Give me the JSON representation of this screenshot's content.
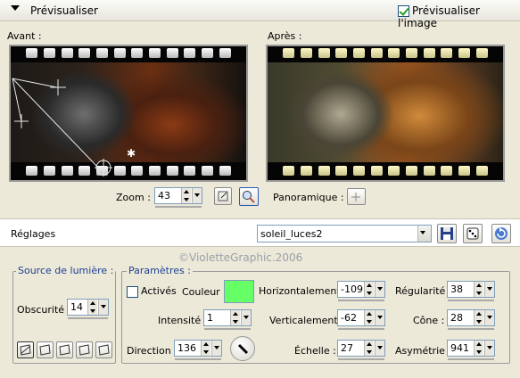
{
  "preview": {
    "title": "Prévisualiser",
    "preview_image_label": "Prévisualiser l'image",
    "preview_image_checked": true,
    "before_label": "Avant :",
    "after_label": "Après :",
    "zoom_label": "Zoom :",
    "zoom_value": "43",
    "pan_label": "Panoramique :"
  },
  "presets": {
    "label": "Réglages",
    "value": "soleil_luces2",
    "watermark": "©VioletteGraphic.2006"
  },
  "light_source": {
    "title": "Source de lumière :",
    "darkness_label": "Obscurité :",
    "darkness_value": "14"
  },
  "params": {
    "title": "Paramètres :",
    "enabled_label": "Activés",
    "enabled_checked": false,
    "color_label": "Couleur :",
    "color_value": "#66ff66",
    "intensity_label": "Intensité :",
    "intensity_value": "1",
    "direction_label": "Direction :",
    "direction_value": "136",
    "horizontal_label": "Horizontalement :",
    "horizontal_value": "-109",
    "vertical_label": "Verticalement :",
    "vertical_value": "-62",
    "scale_label": "Échelle :",
    "scale_value": "27",
    "regularity_label": "Régularité :",
    "regularity_value": "38",
    "cone_label": "Cône :",
    "cone_value": "28",
    "asymmetry_label": "Asymétrie :",
    "asymmetry_value": "941"
  }
}
